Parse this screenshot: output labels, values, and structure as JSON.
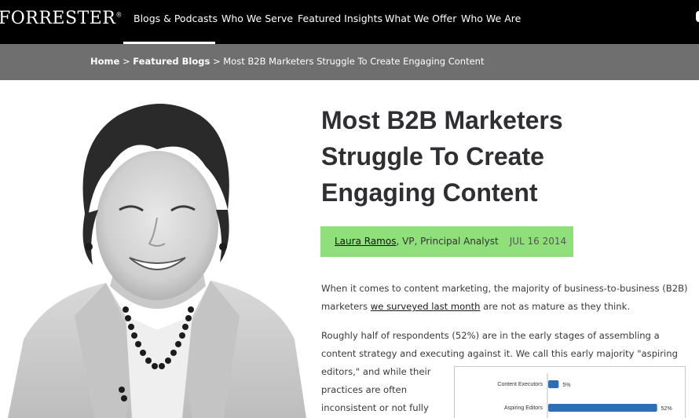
{
  "brand": {
    "logo_text": "FORRESTER",
    "logo_mark": "®"
  },
  "nav": {
    "items": [
      {
        "label": "Blogs & Podcasts"
      },
      {
        "label": "Who We Serve"
      },
      {
        "label": "Featured Insights"
      },
      {
        "label": "What We Offer"
      },
      {
        "label": "Who We Are"
      }
    ]
  },
  "breadcrumb": {
    "home": "Home",
    "sep1": " > ",
    "section": "Featured Blogs",
    "sep2": " > ",
    "current": "Most B2B Marketers Struggle To Create Engaging Content"
  },
  "article": {
    "title_lines": [
      "Most B2B Marketers",
      "Struggle To Create",
      "Engaging Content"
    ],
    "author": "Laura Ramos",
    "author_role": ", VP, Principal Analyst",
    "date": "JUL 16 2014",
    "p1_line1": "When it comes to content marketing, the majority of business-to-business (B2B)",
    "p1_line2_pre": "marketers ",
    "p1_link": "we surveyed last month",
    "p1_line2_post": " are not as mature as they think.",
    "p2_line1": "Roughly half of respondents (52%) are in the early stages of assembling a",
    "p2_line2": "content strategy and executing against it. We call this early majority \"aspiring",
    "p2_line3": "editors,\" and while their",
    "p2_line4": "practices are often",
    "p2_line5": "inconsistent or not fully"
  },
  "colors": {
    "nav_bg": "#000000",
    "crumb_bg": "#6f6f6f",
    "byline_bg": "#8fe07a",
    "bar": "#2f6db5"
  },
  "chart_data": {
    "type": "bar",
    "orientation": "horizontal",
    "categories": [
      "Content Executors",
      "Aspiring Editors"
    ],
    "values": [
      5,
      52
    ],
    "data_labels": [
      "5%",
      "52%"
    ]
  }
}
